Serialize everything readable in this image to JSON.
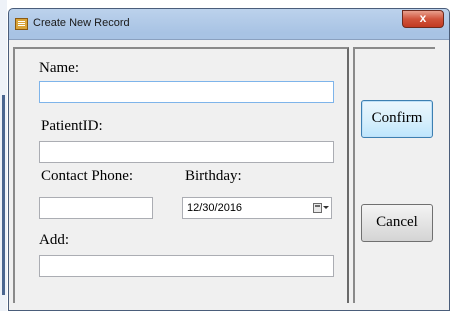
{
  "window": {
    "title": "Create New Record",
    "close_symbol": "x",
    "app_icon": "form-icon"
  },
  "form": {
    "name_label": "Name:",
    "name_value": "",
    "patient_id_label": "PatientID:",
    "patient_id_value": "",
    "contact_phone_label": "Contact Phone:",
    "contact_phone_value": "",
    "birthday_label": "Birthday:",
    "birthday_value": "12/30/2016",
    "add_label": "Add:",
    "add_value": ""
  },
  "actions": {
    "confirm_label": "Confirm",
    "cancel_label": "Cancel"
  },
  "colors": {
    "title_gradient": "#a8c3e4",
    "close_button": "#c23a22",
    "focused_border": "#7eb4ea",
    "default_button": "#3c7fb1"
  }
}
